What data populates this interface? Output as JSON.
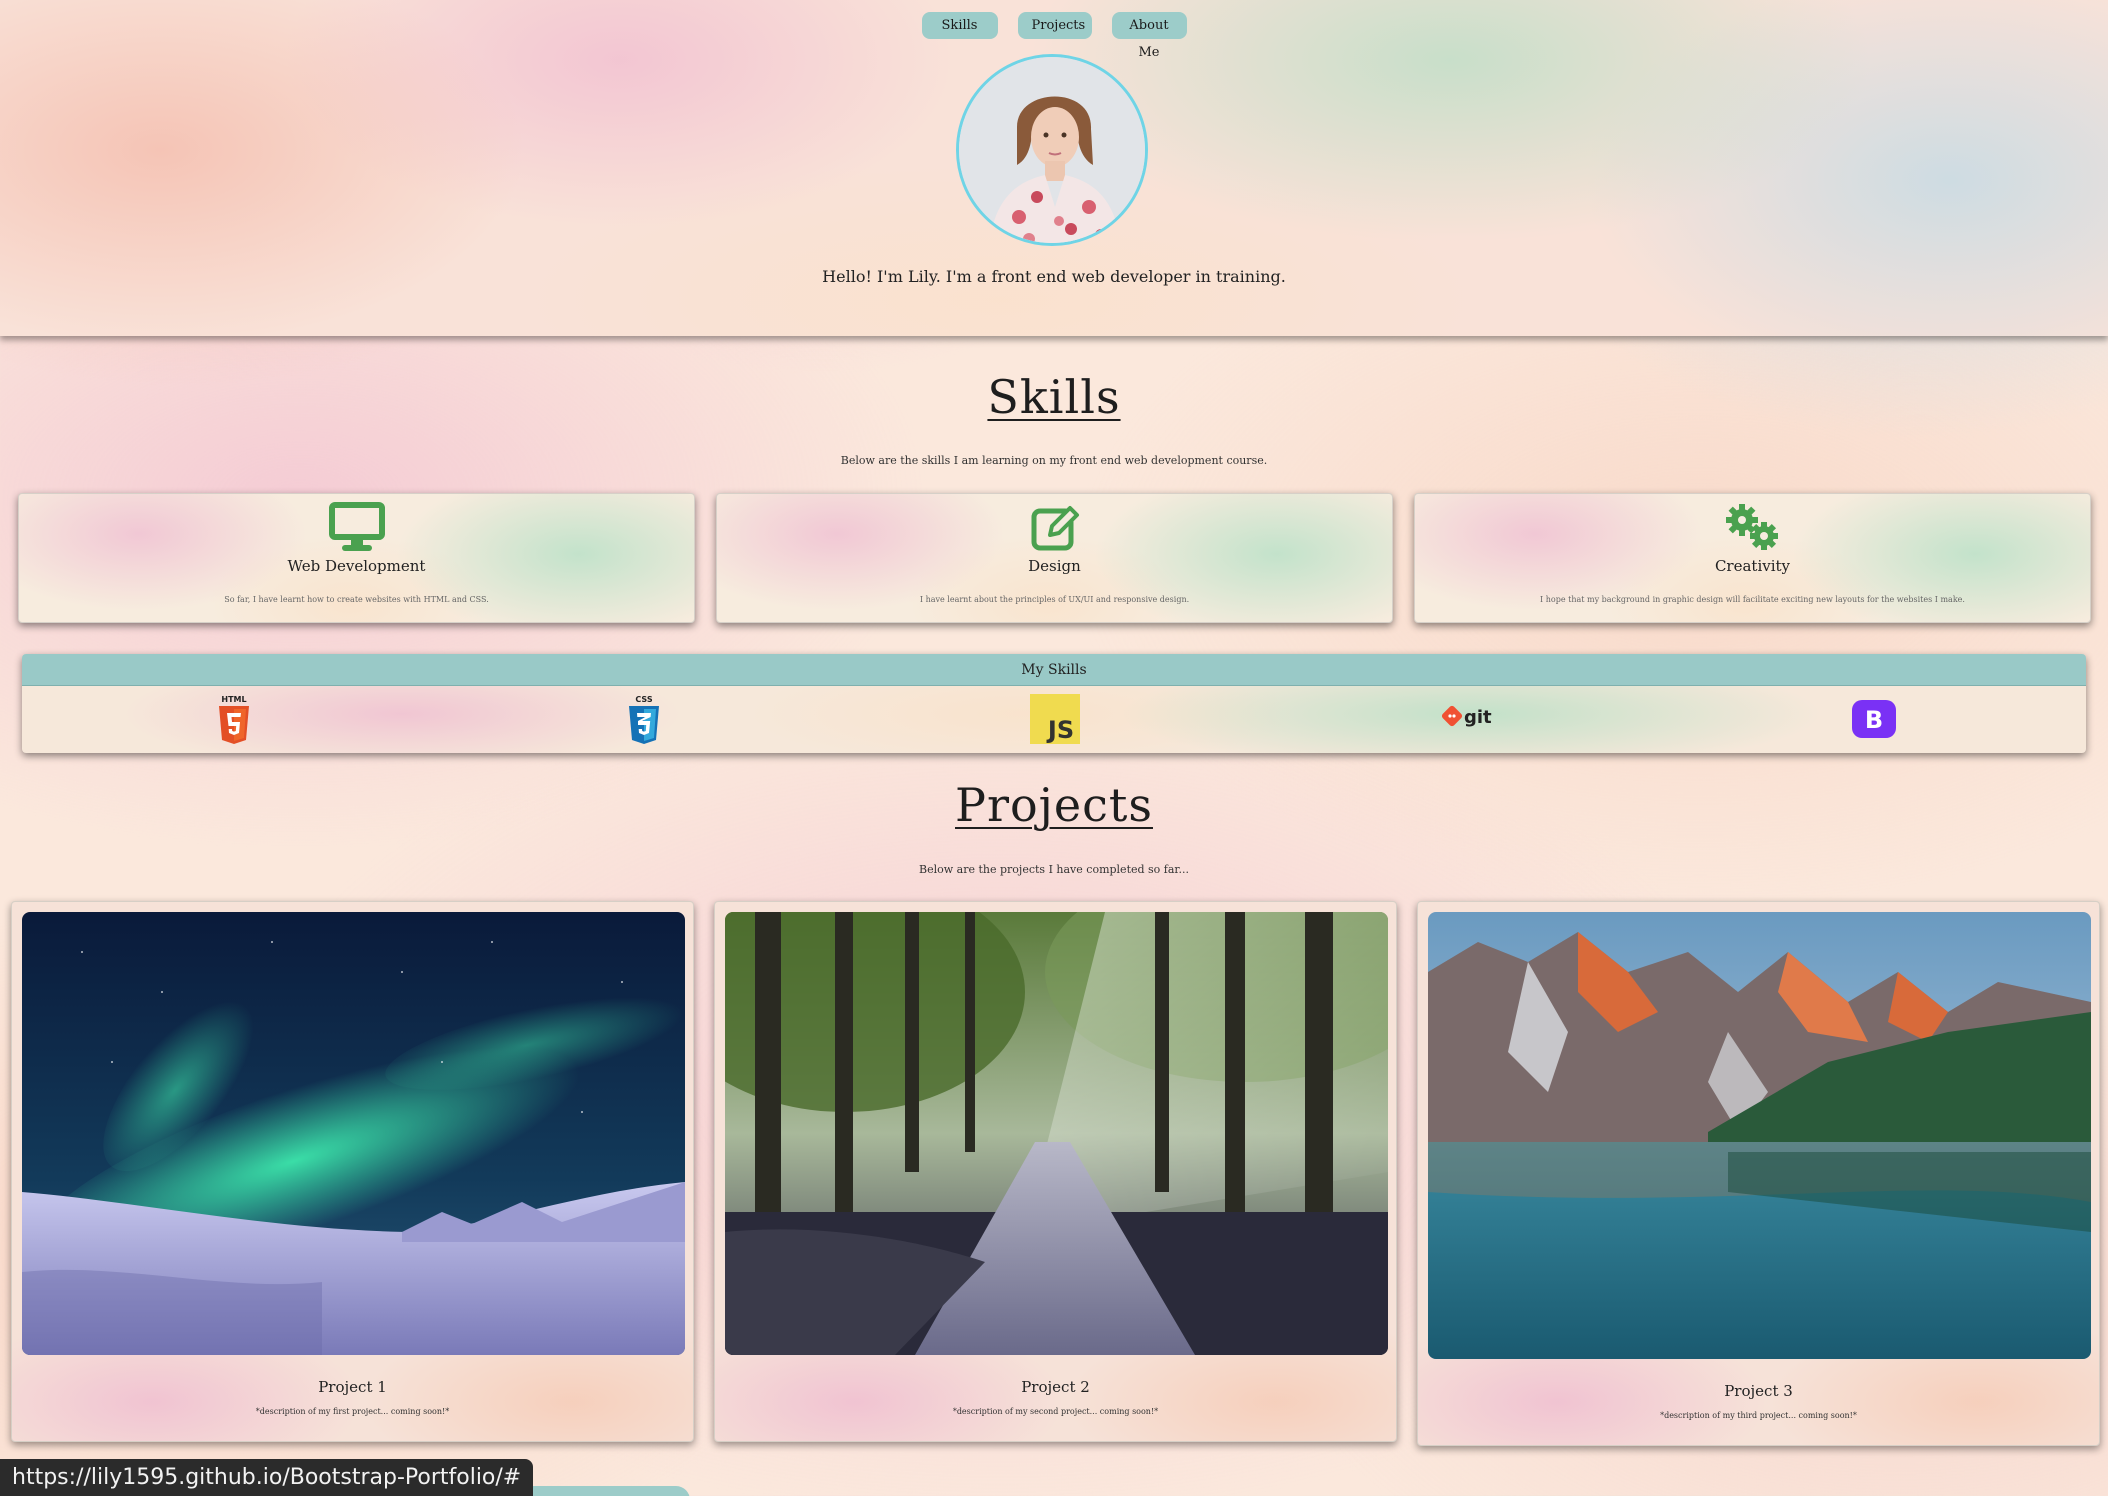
{
  "nav": {
    "items": [
      {
        "label": "Skills"
      },
      {
        "label": "Projects"
      },
      {
        "label": "About Me"
      }
    ]
  },
  "header": {
    "avatar_alt": "profile photo",
    "tagline": "Hello! I'm Lily. I'm a front end web developer in training."
  },
  "skills": {
    "title": "Skills",
    "subtitle": "Below are the skills I am learning on my front end web development course.",
    "cards": [
      {
        "icon": "desktop-icon",
        "title": "Web Development",
        "desc": "So far, I have learnt how to create websites with HTML and CSS."
      },
      {
        "icon": "edit-icon",
        "title": "Design",
        "desc": "I have learnt about the principles of UX/UI and responsive design."
      },
      {
        "icon": "gears-icon",
        "title": "Creativity",
        "desc": "I hope that my background in graphic design will facilitate exciting new layouts for the websites I make."
      }
    ],
    "icon_color": "#4aa14f"
  },
  "my_skills": {
    "title": "My Skills",
    "logos": [
      "html5-icon",
      "css3-icon",
      "javascript-icon",
      "git-icon",
      "bootstrap-icon"
    ],
    "logo_text": {
      "html": "HTML",
      "css": "CSS",
      "js": "JS",
      "git": "git",
      "bootstrap": "B"
    }
  },
  "projects": {
    "title": "Projects",
    "subtitle": "Below are the projects I have completed so far...",
    "items": [
      {
        "title": "Project 1",
        "desc": "*description of my first project... coming soon!*",
        "image": "aurora"
      },
      {
        "title": "Project 2",
        "desc": "*description of my second project... coming soon!*",
        "image": "forest"
      },
      {
        "title": "Project 3",
        "desc": "*description of my third project... coming soon!*",
        "image": "mountain-lake"
      }
    ]
  },
  "status_bar": {
    "url": "https://lily1595.github.io/Bootstrap-Portfolio/#"
  }
}
